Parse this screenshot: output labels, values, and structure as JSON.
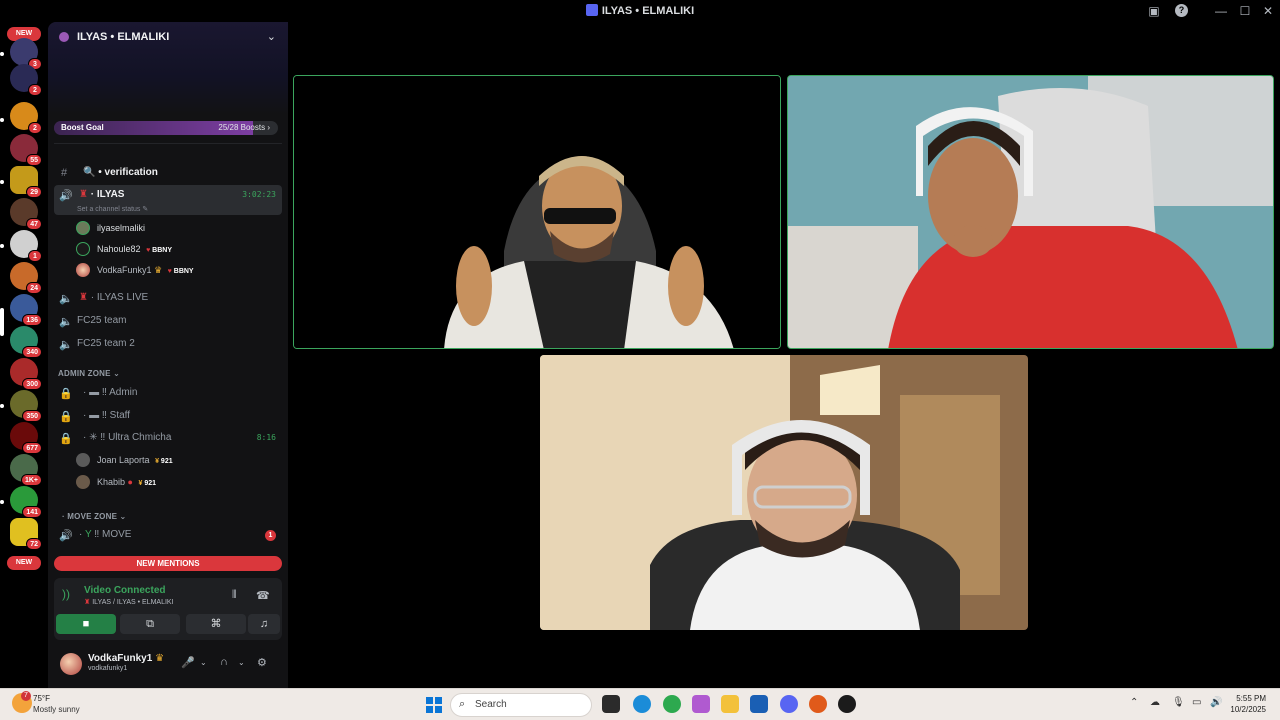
{
  "window": {
    "title": "ILYAS • ELMALIKI",
    "help_icon": "help-icon",
    "inbox_icon": "inbox-icon",
    "minimize": "—",
    "maximize": "☐",
    "close": "✕"
  },
  "server_rail": {
    "new_top": "NEW",
    "new_bottom": "NEW",
    "badges": [
      "3",
      "2",
      "2",
      "55",
      "29",
      "47",
      "1",
      "24",
      "136",
      "340",
      "300",
      "350",
      "677",
      "1K+",
      "141",
      "72"
    ]
  },
  "server": {
    "name": "ILYAS • ELMALIKI",
    "boost_label": "Boost Goal",
    "boost_count": "25/28 Boosts",
    "boost_progress": 0.89
  },
  "channels": {
    "verification": "• verification",
    "ilyas": "ILYAS",
    "ilyas_time": "3:02:23",
    "ilyas_status": "Set a channel status",
    "ilyas_live": "ILYAS LIVE",
    "fc25_team": "FC25 team",
    "fc25_team2": "FC25 team 2",
    "admin_zone": "ADMIN ZONE",
    "admin": "Admin",
    "staff": "Staff",
    "ultra": "Ultra Chmicha",
    "ultra_time": "8:16",
    "move_zone": "MOVE ZONE",
    "move": "MOVE",
    "move_badge": "1",
    "new_mentions": "NEW MENTIONS"
  },
  "voice_users": [
    {
      "name": "ilyaselmaliki",
      "tag": ""
    },
    {
      "name": "Nahoule82",
      "tag": "BBNY"
    },
    {
      "name": "VodkaFunky1",
      "tag": "BBNY"
    }
  ],
  "ultra_users": [
    {
      "name": "Joan Laporta",
      "tag": "921"
    },
    {
      "name": "Khabib",
      "tag": "921"
    }
  ],
  "voice_panel": {
    "status": "Video Connected",
    "location": "ILYAS / ILYAS • ELMALIKI"
  },
  "user_panel": {
    "name": "VodkaFunky1",
    "handle": "vodkafunky1"
  },
  "taskbar": {
    "temp": "75°F",
    "weather": "Mostly sunny",
    "weather_badge": "7",
    "search_placeholder": "Search",
    "time": "5:55 PM",
    "date": "10/2/2025"
  },
  "colors": {
    "accent_green": "#3ba55d",
    "danger_red": "#da373c",
    "sidebar_bg": "#121214",
    "boost_purple": "#7d3ea3"
  }
}
